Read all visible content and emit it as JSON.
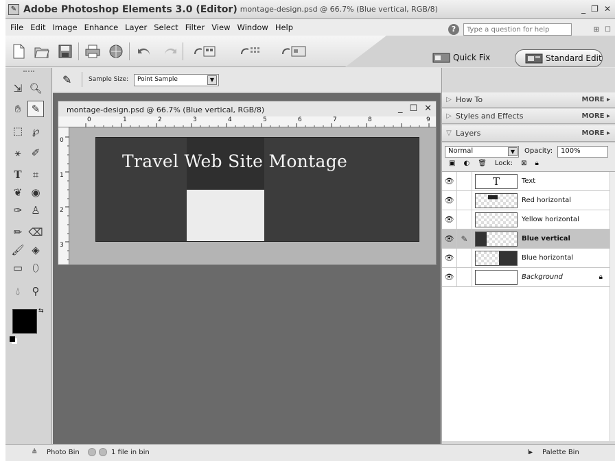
{
  "window": {
    "app_title": "Adobe Photoshop Elements 3.0 (Editor)",
    "doc_title": "montage-design.psd @ 66.7% (Blue vertical, RGB/8)"
  },
  "menu": [
    "File",
    "Edit",
    "Image",
    "Enhance",
    "Layer",
    "Select",
    "Filter",
    "View",
    "Window",
    "Help"
  ],
  "help": {
    "placeholder": "Type a question for help"
  },
  "modes": {
    "quick_fix": "Quick Fix",
    "standard_edit": "Standard Edit"
  },
  "options": {
    "sample_size_label": "Sample Size:",
    "sample_size_value": "Point Sample"
  },
  "document": {
    "title": "montage-design.psd @ 66.7% (Blue vertical, RGB/8)",
    "canvas_text": "Travel Web Site Montage",
    "ruler_h": [
      "0",
      "1",
      "2",
      "3",
      "4",
      "5",
      "6",
      "7",
      "8",
      "9"
    ],
    "ruler_v": [
      "0",
      "1",
      "2",
      "3"
    ]
  },
  "palettes": {
    "how_to": "How To",
    "styles": "Styles and Effects",
    "layers": "Layers",
    "more": "MORE"
  },
  "layer_controls": {
    "blend_mode": "Normal",
    "opacity_label": "Opacity:",
    "opacity_value": "100%",
    "lock_label": "Lock:"
  },
  "layers": [
    {
      "name": "Text",
      "active": false
    },
    {
      "name": "Red horizontal",
      "active": false
    },
    {
      "name": "Yellow horizontal",
      "active": false
    },
    {
      "name": "Blue vertical",
      "active": true
    },
    {
      "name": "Blue horizontal",
      "active": false
    },
    {
      "name": "Background",
      "active": false
    }
  ],
  "status": {
    "photo_bin": "Photo Bin",
    "file_count": "1 file in bin",
    "palette_bin": "Palette Bin"
  },
  "colors": {
    "foreground": "#000000",
    "background": "#ffffff"
  }
}
